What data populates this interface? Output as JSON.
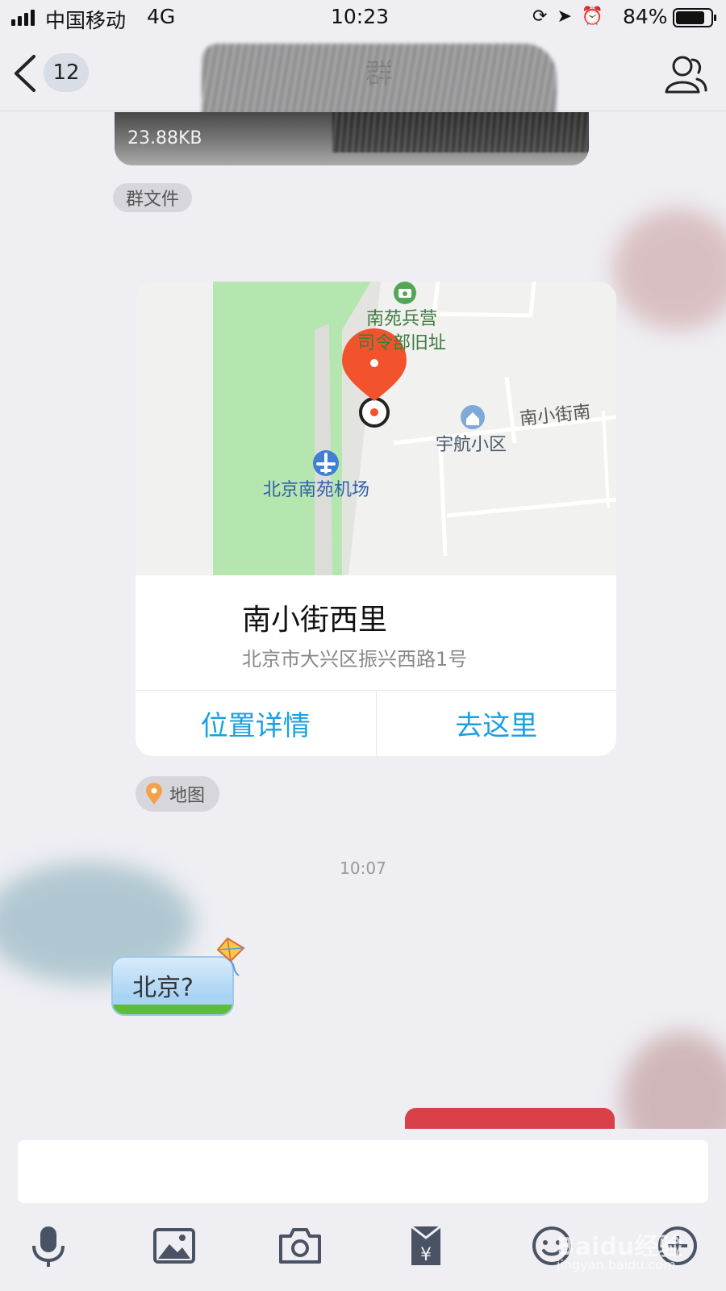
{
  "status_bar": {
    "carrier": "中国移动",
    "network": "4G",
    "time": "10:23",
    "battery_percent": "84%",
    "battery_level": 0.84
  },
  "nav": {
    "unread_count": "12",
    "title": "群"
  },
  "messages": {
    "file": {
      "size": "23.88KB",
      "tag": "群文件"
    },
    "location": {
      "map_labels": {
        "barracks_line1": "南苑兵营",
        "barracks_line2": "司令部旧址",
        "street": "南小街南",
        "community": "宇航小区",
        "airport": "北京南苑机场"
      },
      "place_name": "南小街西里",
      "address": "北京市大兴区振兴西路1号",
      "action_details": "位置详情",
      "action_go": "去这里",
      "tag": "地图"
    },
    "timestamp": "10:07",
    "text_bubble": "北京?"
  },
  "colors": {
    "accent": "#1aa0e0",
    "pin": "#f2532d",
    "background": "#eeeef3"
  },
  "watermark": {
    "main": "Baidu经验",
    "sub": "jingyan.baidu.com"
  }
}
